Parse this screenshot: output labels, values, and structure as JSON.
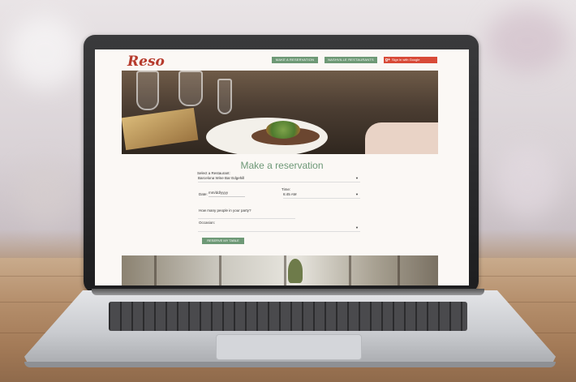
{
  "header": {
    "logo": "Reso",
    "nav": {
      "make_reservation": "MAKE A RESERVATION",
      "nashville_restaurants": "NASHVILLE RESTAURANTS",
      "google_icon": "g+",
      "google_signin": "Sign in with Google"
    }
  },
  "form": {
    "title": "Make a reservation",
    "restaurant_label": "Select a Restaurant:",
    "restaurant_value": "Barcelona Wine Bar Edgehill",
    "date_label": "Date:",
    "date_placeholder": "mm/dd/yyyy",
    "time_label": "Time:",
    "time_value": "6:45 AM",
    "party_label": "How many people in your party?",
    "occasion_label": "Occasion:",
    "occasion_value": "",
    "submit_label": "RESERVE MY TABLE"
  },
  "icons": {
    "dropdown": "▼"
  },
  "colors": {
    "brand_red": "#b63a2c",
    "accent_green": "#6e9976",
    "google_red": "#d84a38"
  }
}
